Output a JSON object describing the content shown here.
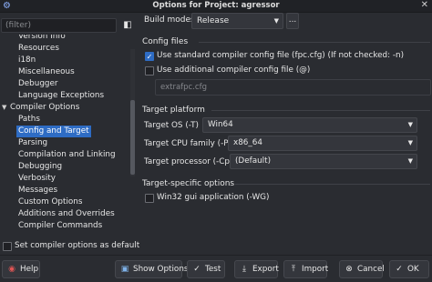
{
  "window": {
    "title": "Options for Project: agressor"
  },
  "filter": {
    "placeholder": "(filter)"
  },
  "tree": {
    "items": [
      {
        "label": "Version Info"
      },
      {
        "label": "Resources"
      },
      {
        "label": "i18n"
      },
      {
        "label": "Miscellaneous"
      },
      {
        "label": "Debugger"
      },
      {
        "label": "Language Exceptions"
      },
      {
        "label": "Compiler Options"
      },
      {
        "label": "Paths"
      },
      {
        "label": "Config and Target"
      },
      {
        "label": "Parsing"
      },
      {
        "label": "Compilation and Linking"
      },
      {
        "label": "Debugging"
      },
      {
        "label": "Verbosity"
      },
      {
        "label": "Messages"
      },
      {
        "label": "Custom Options"
      },
      {
        "label": "Additions and Overrides"
      },
      {
        "label": "Compiler Commands"
      }
    ],
    "selected": "Config and Target"
  },
  "set_default": {
    "label": "Set compiler options as default"
  },
  "build_modes": {
    "label": "Build modes",
    "value": "Release",
    "more": "..."
  },
  "config_files": {
    "title": "Config files",
    "use_standard": "Use standard compiler config file (fpc.cfg) (If not checked: -n)",
    "use_additional": "Use additional compiler config file (@)",
    "path_placeholder": "extrafpc.cfg"
  },
  "target_platform": {
    "title": "Target platform",
    "os_label": "Target OS (-T)",
    "os_value": "Win64",
    "cpu_label": "Target CPU family (-P)",
    "cpu_value": "x86_64",
    "proc_label": "Target processor (-Cp)",
    "proc_value": "(Default)"
  },
  "target_specific": {
    "title": "Target-specific options",
    "win32_gui": "Win32 gui application (-WG)"
  },
  "buttons": {
    "help": "Help",
    "show_options": "Show Options",
    "test": "Test",
    "export": "Export",
    "import": "Import",
    "cancel": "Cancel",
    "ok": "OK"
  },
  "colors": {
    "accent": "#2e6cc4",
    "background": "#2a2c31"
  }
}
